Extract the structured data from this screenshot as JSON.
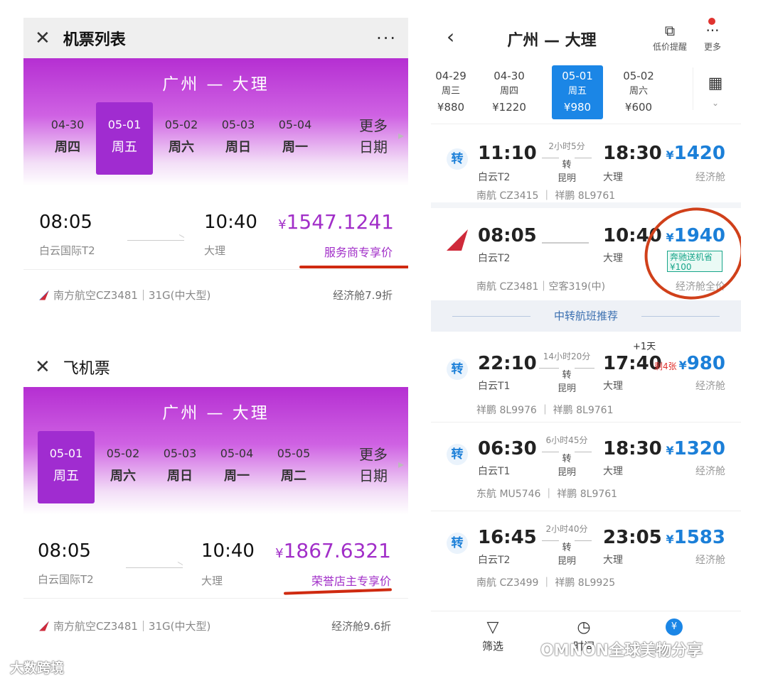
{
  "panel1": {
    "title": "机票列表",
    "route": "广州 — 大理",
    "dates": [
      {
        "date": "04-30",
        "weekday": "周四"
      },
      {
        "date": "05-01",
        "weekday": "周五",
        "selected": true
      },
      {
        "date": "05-02",
        "weekday": "周六"
      },
      {
        "date": "05-03",
        "weekday": "周日"
      },
      {
        "date": "05-04",
        "weekday": "周一"
      }
    ],
    "more": [
      "更多",
      "日期"
    ],
    "flight": {
      "depart_time": "08:05",
      "depart_airport": "白云国际T2",
      "arrive_time": "10:40",
      "arrive_airport": "大理",
      "price_symbol": "¥",
      "price": "1547.1241",
      "price_tag": "服务商专享价",
      "airline": "南方航空CZ3481｜31G(中大型)",
      "cabin": "经济舱7.9折"
    }
  },
  "panel2": {
    "title": "飞机票",
    "route": "广州 — 大理",
    "dates": [
      {
        "date": "05-01",
        "weekday": "周五",
        "selected": true
      },
      {
        "date": "05-02",
        "weekday": "周六"
      },
      {
        "date": "05-03",
        "weekday": "周日"
      },
      {
        "date": "05-04",
        "weekday": "周一"
      },
      {
        "date": "05-05",
        "weekday": "周二"
      }
    ],
    "more": [
      "更多",
      "日期"
    ],
    "flight": {
      "depart_time": "08:05",
      "depart_airport": "白云国际T2",
      "arrive_time": "10:40",
      "arrive_airport": "大理",
      "price_symbol": "¥",
      "price": "1867.6321",
      "price_tag": "荣誉店主专享价",
      "airline": "南方航空CZ3481｜31G(中大型)",
      "cabin": "经济舱9.6折"
    }
  },
  "panel3": {
    "title": "广州 — 大理",
    "actions": {
      "low_price": "低价提醒",
      "more": "更多"
    },
    "dates": [
      {
        "date": "04-29",
        "weekday": "周三",
        "price": "¥880"
      },
      {
        "date": "04-30",
        "weekday": "周四",
        "price": "¥1220"
      },
      {
        "date": "05-01",
        "weekday": "周五",
        "price": "¥980",
        "selected": true
      },
      {
        "date": "05-02",
        "weekday": "周六",
        "price": "¥600"
      }
    ],
    "flights": [
      {
        "transfer": "转",
        "dep": "11:10",
        "dep_ap": "白云T2",
        "dur": "2小时5分",
        "via_mark": "转",
        "via": "昆明",
        "arr": "18:30",
        "arr_ap": "大理",
        "price": "1420",
        "cabin": "经济舱",
        "airlines": "南航 CZ3415 ｜ 祥鹏 8L9761"
      },
      {
        "transfer": "",
        "dep": "08:05",
        "dep_ap": "白云T2",
        "dur": "",
        "via_mark": "",
        "via": "",
        "arr": "10:40",
        "arr_ap": "大理",
        "price": "1940",
        "cabin": "经济舱全价",
        "airlines": "南航 CZ3481｜空客319(中)",
        "promo": "奔驰送机省",
        "promo_amount": "¥100"
      }
    ],
    "section_title": "中转航班推荐",
    "transfer_flights": [
      {
        "transfer": "转",
        "dep": "22:10",
        "dep_ap": "白云T1",
        "dur": "14小时20分",
        "via_mark": "转",
        "via": "昆明",
        "arr": "17:40",
        "next_day": "+1天",
        "arr_ap": "大理",
        "remaining": "剩4张",
        "price": "980",
        "cabin": "经济舱",
        "airlines": "祥鹏 8L9976 ｜ 祥鹏 8L9761"
      },
      {
        "transfer": "转",
        "dep": "06:30",
        "dep_ap": "白云T1",
        "dur": "6小时45分",
        "via_mark": "转",
        "via": "昆明",
        "arr": "18:30",
        "arr_ap": "大理",
        "price": "1320",
        "cabin": "经济舱",
        "airlines": "东航 MU5746 ｜ 祥鹏 8L9761"
      },
      {
        "transfer": "转",
        "dep": "16:45",
        "dep_ap": "白云T2",
        "dur": "2小时40分",
        "via_mark": "转",
        "via": "昆明",
        "arr": "23:05",
        "arr_ap": "大理",
        "price": "1583",
        "cabin": "经济舱",
        "airlines": "南航 CZ3499 ｜ 祥鹏 8L9925"
      }
    ],
    "bottom_nav": {
      "filter": "筛选",
      "time": "时间",
      "price_icon": "¥"
    }
  },
  "watermarks": {
    "left": "大数跨境",
    "right": "OMNON全球美物分享"
  }
}
